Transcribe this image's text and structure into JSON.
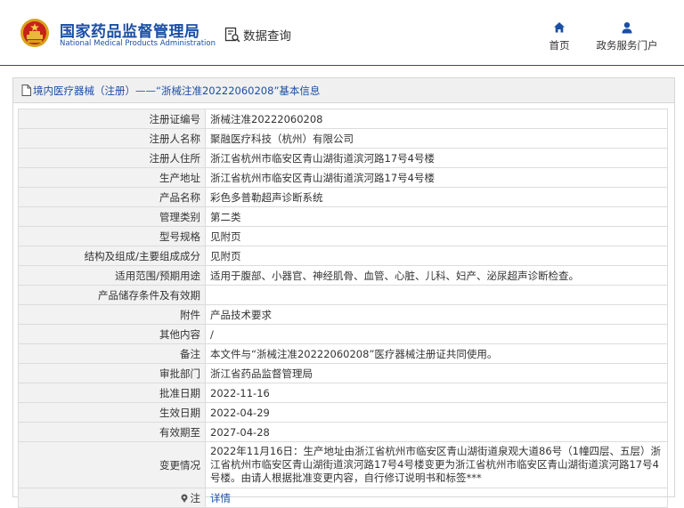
{
  "header": {
    "org_name_cn": "国家药品监督管理局",
    "org_name_en": "National Medical Products Administration",
    "query_label": "数据查询",
    "nav": [
      {
        "label": "首页",
        "icon": "home-icon"
      },
      {
        "label": "政务服务门户",
        "icon": "user-icon"
      }
    ]
  },
  "panel": {
    "title": "境内医疗器械（注册）——“浙械注准20222060208”基本信息"
  },
  "rows": [
    {
      "label": "注册证编号",
      "value": "浙械注准20222060208"
    },
    {
      "label": "注册人名称",
      "value": "聚融医疗科技（杭州）有限公司"
    },
    {
      "label": "注册人住所",
      "value": "浙江省杭州市临安区青山湖街道滨河路17号4号楼"
    },
    {
      "label": "生产地址",
      "value": "浙江省杭州市临安区青山湖街道滨河路17号4号楼"
    },
    {
      "label": "产品名称",
      "value": "彩色多普勒超声诊断系统"
    },
    {
      "label": "管理类别",
      "value": "第二类"
    },
    {
      "label": "型号规格",
      "value": "见附页"
    },
    {
      "label": "结构及组成/主要组成成分",
      "value": "见附页"
    },
    {
      "label": "适用范围/预期用途",
      "value": "适用于腹部、小器官、神经肌骨、血管、心脏、儿科、妇产、泌尿超声诊断检查。"
    },
    {
      "label": "产品储存条件及有效期",
      "value": ""
    },
    {
      "label": "附件",
      "value": "产品技术要求"
    },
    {
      "label": "其他内容",
      "value": "/"
    },
    {
      "label": "备注",
      "value": "本文件与“浙械注准20222060208”医疗器械注册证共同使用。"
    },
    {
      "label": "审批部门",
      "value": "浙江省药品监督管理局"
    },
    {
      "label": "批准日期",
      "value": "2022-11-16"
    },
    {
      "label": "生效日期",
      "value": "2022-04-29"
    },
    {
      "label": "有效期至",
      "value": "2027-04-28"
    },
    {
      "label": "变更情况",
      "value": "2022年11月16日：生产地址由浙江省杭州市临安区青山湖街道泉观大道86号（1幢四层、五层）浙江省杭州市临安区青山湖街道滨河路17号4号楼变更为浙江省杭州市临安区青山湖街道滨河路17号4号楼。由请人根据批准变更内容，自行修订说明书和标签***"
    },
    {
      "label": "注",
      "value": "详情",
      "label_icon": "info-pin-icon"
    }
  ],
  "colors": {
    "accent": "#1b4fa3",
    "label_bg": "#f2f2f2",
    "border": "#dcdcdc"
  }
}
